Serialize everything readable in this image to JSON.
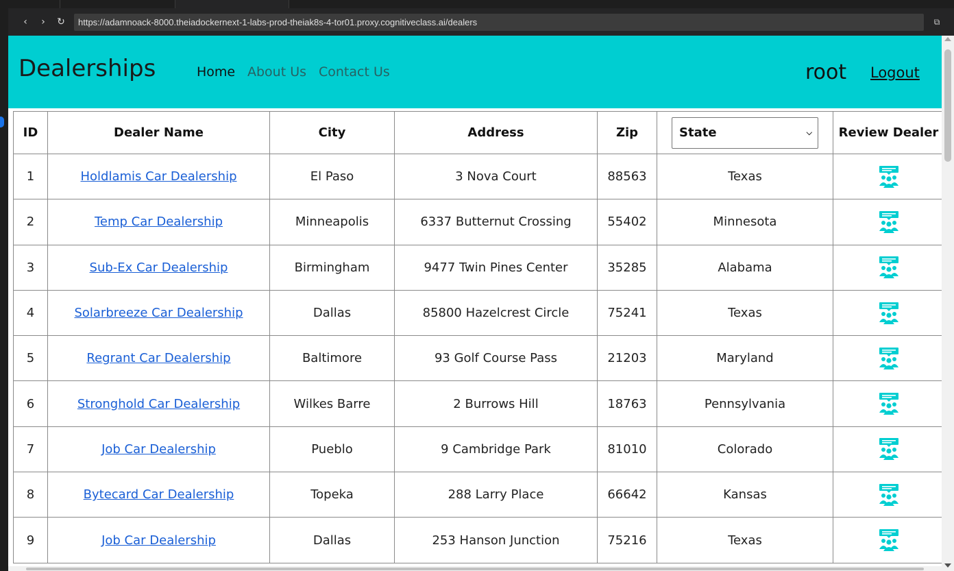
{
  "browser": {
    "url": "https://adamnoack-8000.theiadockernext-1-labs-prod-theiak8s-4-tor01.proxy.cognitiveclass.ai/dealers",
    "back_glyph": "‹",
    "forward_glyph": "›",
    "reload_glyph": "↻",
    "external_glyph": "⧉"
  },
  "header": {
    "brand": "Dealerships",
    "nav": [
      {
        "label": "Home"
      },
      {
        "label": "About Us"
      },
      {
        "label": "Contact Us"
      }
    ],
    "username": "root",
    "logout": "Logout",
    "background_color": "#00ced1"
  },
  "table": {
    "columns": [
      "ID",
      "Dealer Name",
      "City",
      "Address",
      "Zip",
      "State",
      "Review Dealer"
    ],
    "state_filter": {
      "selected": "State"
    },
    "review_icon": "review-people-icon",
    "icon_color": "#00ced1",
    "rows": [
      {
        "id": "1",
        "name": "Holdlamis Car Dealership",
        "city": "El Paso",
        "address": "3 Nova Court",
        "zip": "88563",
        "state": "Texas"
      },
      {
        "id": "2",
        "name": "Temp Car Dealership",
        "city": "Minneapolis",
        "address": "6337 Butternut Crossing",
        "zip": "55402",
        "state": "Minnesota"
      },
      {
        "id": "3",
        "name": "Sub-Ex Car Dealership",
        "city": "Birmingham",
        "address": "9477 Twin Pines Center",
        "zip": "35285",
        "state": "Alabama"
      },
      {
        "id": "4",
        "name": "Solarbreeze Car Dealership",
        "city": "Dallas",
        "address": "85800 Hazelcrest Circle",
        "zip": "75241",
        "state": "Texas"
      },
      {
        "id": "5",
        "name": "Regrant Car Dealership",
        "city": "Baltimore",
        "address": "93 Golf Course Pass",
        "zip": "21203",
        "state": "Maryland"
      },
      {
        "id": "6",
        "name": "Stronghold Car Dealership",
        "city": "Wilkes Barre",
        "address": "2 Burrows Hill",
        "zip": "18763",
        "state": "Pennsylvania"
      },
      {
        "id": "7",
        "name": "Job Car Dealership",
        "city": "Pueblo",
        "address": "9 Cambridge Park",
        "zip": "81010",
        "state": "Colorado"
      },
      {
        "id": "8",
        "name": "Bytecard Car Dealership",
        "city": "Topeka",
        "address": "288 Larry Place",
        "zip": "66642",
        "state": "Kansas"
      },
      {
        "id": "9",
        "name": "Job Car Dealership",
        "city": "Dallas",
        "address": "253 Hanson Junction",
        "zip": "75216",
        "state": "Texas"
      }
    ]
  }
}
